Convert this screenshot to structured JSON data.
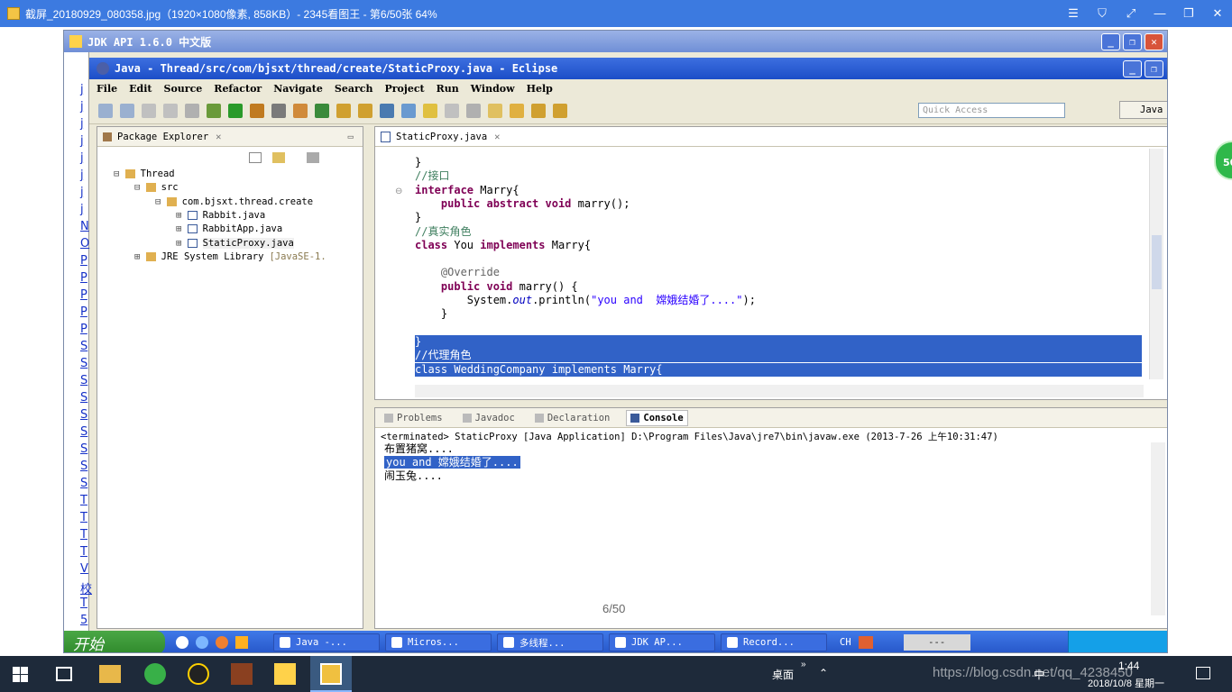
{
  "viewer": {
    "title": "截屏_20180929_080358.jpg（1920×1080像素, 858KB）- 2345看图王 - 第6/50张 64%",
    "page_indicator": "6/50",
    "badge": "50",
    "controls": [
      "☰",
      "⛉",
      "⤢",
      "—",
      "❐",
      "✕"
    ]
  },
  "jdk_window": {
    "title": "JDK API 1.6.0 中文版",
    "left_links": [
      "j",
      "j",
      "j",
      "j",
      "j",
      "j",
      "j",
      "j",
      "N",
      "O",
      "P",
      "P",
      "P",
      "P",
      "P",
      "S",
      "S",
      "S",
      "S",
      "S",
      "S",
      "S",
      "S",
      "S",
      "T",
      "T",
      "T",
      "T",
      "V",
      "校",
      "T",
      "5"
    ]
  },
  "eclipse": {
    "title": "Java - Thread/src/com/bjsxt/thread/create/StaticProxy.java - Eclipse",
    "menu": [
      "File",
      "Edit",
      "Source",
      "Refactor",
      "Navigate",
      "Search",
      "Project",
      "Run",
      "Window",
      "Help"
    ],
    "quick_access_placeholder": "Quick Access",
    "perspective_label": "Java",
    "package_explorer": {
      "tab": "Package Explorer",
      "tree": [
        {
          "label": "Thread",
          "depth": 0
        },
        {
          "label": "src",
          "depth": 1
        },
        {
          "label": "com.bjsxt.thread.create",
          "depth": 2
        },
        {
          "label": "Rabbit.java",
          "depth": 3
        },
        {
          "label": "RabbitApp.java",
          "depth": 3
        },
        {
          "label": "StaticProxy.java",
          "depth": 3
        },
        {
          "label": "JRE System Library",
          "suffix": "[JavaSE-1.",
          "depth": 1
        }
      ]
    },
    "editor": {
      "tab": "StaticProxy.java",
      "lines": [
        {
          "p": [
            [
              "",
              "}"
            ]
          ]
        },
        {
          "p": [
            [
              "cm",
              "//接口"
            ]
          ]
        },
        {
          "p": [
            [
              "kw",
              "interface"
            ],
            [
              "",
              " Marry{"
            ]
          ]
        },
        {
          "p": [
            [
              "",
              "    "
            ],
            [
              "kw",
              "public abstract void"
            ],
            [
              "",
              " marry();"
            ]
          ]
        },
        {
          "p": [
            [
              "",
              "}"
            ]
          ]
        },
        {
          "p": [
            [
              "cm",
              "//真实角色"
            ]
          ]
        },
        {
          "p": [
            [
              "kw",
              "class"
            ],
            [
              "",
              " You "
            ],
            [
              "kw",
              "implements"
            ],
            [
              "",
              " Marry{"
            ]
          ]
        },
        {
          "p": [
            [
              "",
              ""
            ]
          ]
        },
        {
          "p": [
            [
              "",
              "    "
            ],
            [
              "an",
              "@Override"
            ]
          ]
        },
        {
          "p": [
            [
              "",
              "    "
            ],
            [
              "kw",
              "public void"
            ],
            [
              "",
              " marry() {"
            ]
          ]
        },
        {
          "p": [
            [
              "",
              "        System."
            ],
            [
              "it",
              "out"
            ],
            [
              "",
              ".println("
            ],
            [
              "st",
              "\"you and  嫦娥结婚了....\""
            ],
            [
              "",
              ");"
            ]
          ]
        },
        {
          "p": [
            [
              "",
              "    }"
            ]
          ]
        },
        {
          "p": [
            [
              "",
              ""
            ]
          ]
        },
        {
          "p": [
            [
              "",
              "}"
            ]
          ],
          "selected": true
        },
        {
          "p": [
            [
              "",
              "//代理角色"
            ]
          ],
          "selected": true
        },
        {
          "p": [
            [
              "",
              "class WeddingCompany implements Marry{"
            ]
          ],
          "selected": true
        }
      ]
    },
    "bottom_tabs": [
      "Problems",
      "Javadoc",
      "Declaration",
      "Console"
    ],
    "console": {
      "header": "<terminated> StaticProxy [Java Application] D:\\Program Files\\Java\\jre7\\bin\\javaw.exe (2013-7-26 上午10:31:47)",
      "lines": [
        {
          "text": "布置猪窝....",
          "selected": false
        },
        {
          "text": "you and  嫦娥结婚了....",
          "selected": true
        },
        {
          "text": "闹玉兔....",
          "selected": false
        }
      ]
    }
  },
  "xp_taskbar": {
    "start": "开始",
    "tasks": [
      "Java -...",
      "Micros...",
      "多线程...",
      "JDK AP...",
      "Record..."
    ],
    "ime": "CH",
    "box": "---"
  },
  "win_taskbar": {
    "desktop_label": "桌面",
    "lang": "中",
    "overlay_url": "https://blog.csdn.net/qq_4238450",
    "time": "1:44",
    "date": "2018/10/8 星期一"
  }
}
